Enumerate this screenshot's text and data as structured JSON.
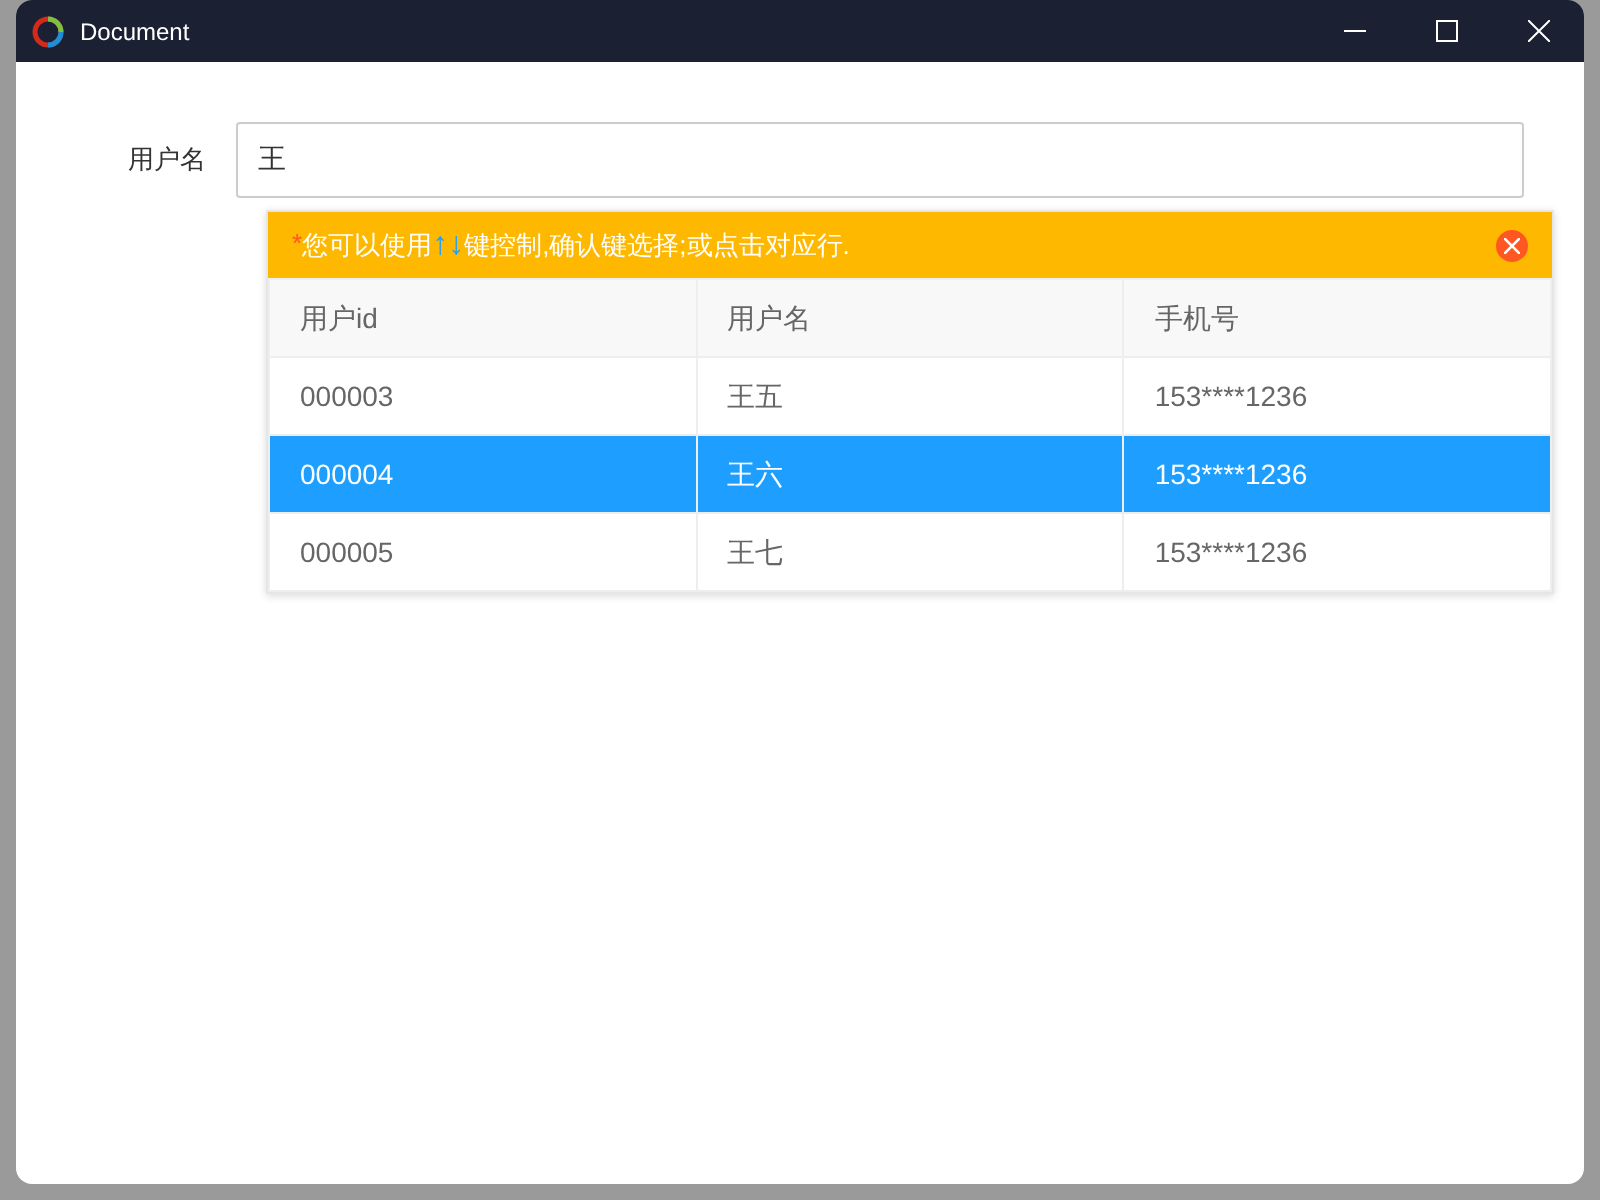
{
  "window": {
    "title": "Document"
  },
  "form": {
    "label": "用户名",
    "value": "王"
  },
  "hint": {
    "mark": "*",
    "lead": "您可以使用",
    "arrows": "↑↓",
    "rest": "键控制,确认键选择;或点击对应行."
  },
  "table": {
    "columns": [
      "用户id",
      "用户名",
      "手机号"
    ],
    "rows": [
      {
        "cells": [
          "000003",
          "王五",
          "153****1236"
        ],
        "selected": false
      },
      {
        "cells": [
          "000004",
          "王六",
          "153****1236"
        ],
        "selected": true
      },
      {
        "cells": [
          "000005",
          "王七",
          "153****1236"
        ],
        "selected": false
      }
    ]
  }
}
